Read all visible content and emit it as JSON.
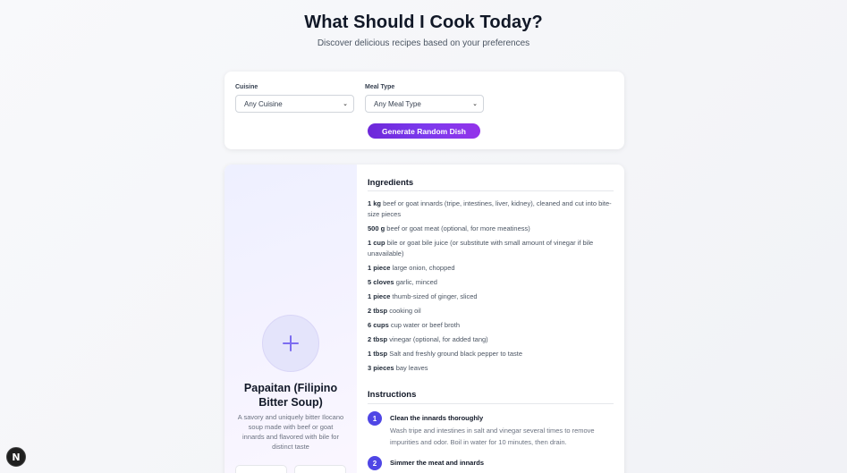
{
  "header": {
    "title": "What Should I Cook Today?",
    "subtitle": "Discover delicious recipes based on your preferences"
  },
  "filters": {
    "cuisine_label": "Cuisine",
    "cuisine_value": "Any Cuisine",
    "meal_type_label": "Meal Type",
    "meal_type_value": "Any Meal Type",
    "generate_label": "Generate Random Dish"
  },
  "recipe": {
    "name": "Papaitan (Filipino Bitter Soup)",
    "description": "A savory and uniquely bitter Ilocano soup made with beef or goat innards and flavored with bile for distinct taste",
    "ingredients_title": "Ingredients",
    "ingredients": [
      {
        "qty": "1 kg",
        "text": "beef or goat innards (tripe, intestines, liver, kidney), cleaned and cut into bite-size pieces"
      },
      {
        "qty": "500 g",
        "text": "beef or goat meat (optional, for more meatiness)"
      },
      {
        "qty": "1 cup",
        "text": "bile or goat bile juice (or substitute with small amount of vinegar if bile unavailable)"
      },
      {
        "qty": "1 piece",
        "text": "large onion, chopped"
      },
      {
        "qty": "5 cloves",
        "text": "garlic, minced"
      },
      {
        "qty": "1 piece",
        "text": "thumb-sized of ginger, sliced"
      },
      {
        "qty": "2 tbsp",
        "text": "cooking oil"
      },
      {
        "qty": "6 cups",
        "text": "cup water or beef broth"
      },
      {
        "qty": "2 tbsp",
        "text": "vinegar (optional, for added tang)"
      },
      {
        "qty": "1 tbsp",
        "text": "Salt and freshly ground black pepper to taste"
      },
      {
        "qty": "3 pieces",
        "text": "bay leaves"
      }
    ],
    "instructions_title": "Instructions",
    "steps": [
      {
        "num": "1",
        "title": "Clean the innards thoroughly",
        "body": "Wash tripe and intestines in salt and vinegar several times to remove impurities and odor. Boil in water for 10 minutes, then drain."
      },
      {
        "num": "2",
        "title": "Simmer the meat and innards",
        "body": ""
      }
    ]
  },
  "dev_badge": {
    "letter": "N"
  },
  "icons": {
    "add": "plus-icon",
    "chevron": "chevron-down-icon"
  },
  "colors": {
    "accent": "#4f46e5",
    "button_gradient_start": "#6d28d9",
    "button_gradient_end": "#9333ea"
  }
}
